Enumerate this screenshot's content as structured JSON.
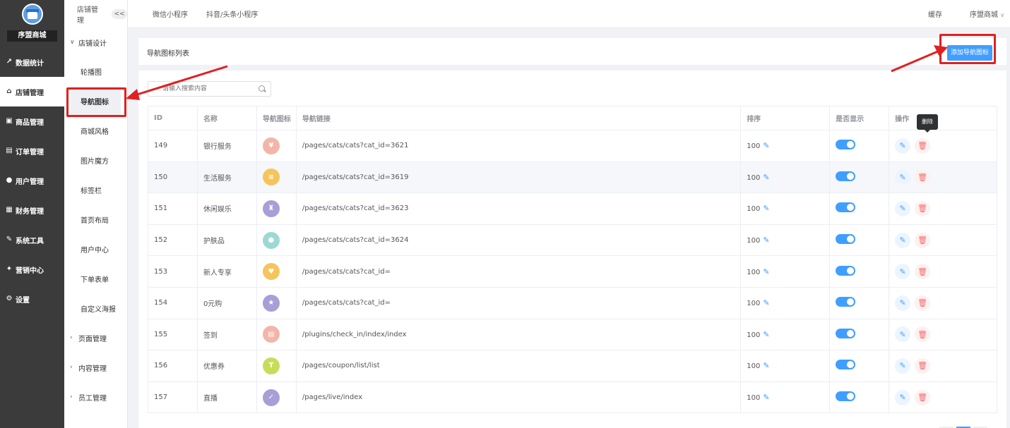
{
  "app": {
    "brand": "序盟商城"
  },
  "main_nav": [
    {
      "label": "数据统计",
      "icon": "chart-icon"
    },
    {
      "label": "店铺管理",
      "icon": "store-icon",
      "active": true
    },
    {
      "label": "商品管理",
      "icon": "goods-icon"
    },
    {
      "label": "订单管理",
      "icon": "order-icon"
    },
    {
      "label": "用户管理",
      "icon": "user-icon"
    },
    {
      "label": "财务管理",
      "icon": "finance-icon"
    },
    {
      "label": "系统工具",
      "icon": "wrench-icon"
    },
    {
      "label": "营销中心",
      "icon": "marketing-icon"
    },
    {
      "label": "设置",
      "icon": "settings-icon"
    }
  ],
  "sub_nav": {
    "header": "店铺管理",
    "collapse_label": "<<",
    "group_expanded": "店铺设计",
    "items": [
      "轮播图",
      "导航图标",
      "商城风格",
      "图片魔方",
      "标签栏",
      "首页布局",
      "用户中心",
      "下单表单",
      "自定义海报"
    ],
    "collapsed_groups": [
      "页面管理",
      "内容管理",
      "员工管理"
    ]
  },
  "topbar": {
    "tabs": [
      "微信小程序",
      "抖音/头条小程序"
    ],
    "cache": "缓存",
    "shop": "序盟商城"
  },
  "panel": {
    "title": "导航图标列表",
    "add_button": "添加导航图标",
    "search_placeholder": "请输入搜索内容",
    "tooltip": "删除"
  },
  "table": {
    "headers": [
      "ID",
      "名称",
      "导航图标",
      "导航链接",
      "排序",
      "是否显示",
      "操作"
    ],
    "rows": [
      {
        "id": "149",
        "name": "银行服务",
        "link": "/pages/cats/cats?cat_id=3621",
        "sort": "100",
        "color": "#f2b5a8",
        "glyph": "¥"
      },
      {
        "id": "150",
        "name": "生活服务",
        "link": "/pages/cats/cats?cat_id=3619",
        "sort": "100",
        "color": "#f5c45b",
        "glyph": "≡"
      },
      {
        "id": "151",
        "name": "休闲娱乐",
        "link": "/pages/cats/cats?cat_id=3623",
        "sort": "100",
        "color": "#a99ed6",
        "glyph": "♜"
      },
      {
        "id": "152",
        "name": "护肤品",
        "link": "/pages/cats/cats?cat_id=3624",
        "sort": "100",
        "color": "#9ed8d6",
        "glyph": "●"
      },
      {
        "id": "153",
        "name": "新人专享",
        "link": "/pages/cats/cats?cat_id=",
        "sort": "100",
        "color": "#f5c45b",
        "glyph": "♥"
      },
      {
        "id": "154",
        "name": "0元购",
        "link": "/pages/cats/cats?cat_id=",
        "sort": "100",
        "color": "#a99ed6",
        "glyph": "★"
      },
      {
        "id": "155",
        "name": "签到",
        "link": "/plugins/check_in/index/index",
        "sort": "100",
        "color": "#f2b5a8",
        "glyph": "▤"
      },
      {
        "id": "156",
        "name": "优惠券",
        "link": "/pages/coupon/list/list",
        "sort": "100",
        "color": "#c9dc5a",
        "glyph": "T"
      },
      {
        "id": "157",
        "name": "直播",
        "link": "/pages/live/index",
        "sort": "100",
        "color": "#a99ed6",
        "glyph": "✓"
      }
    ]
  }
}
